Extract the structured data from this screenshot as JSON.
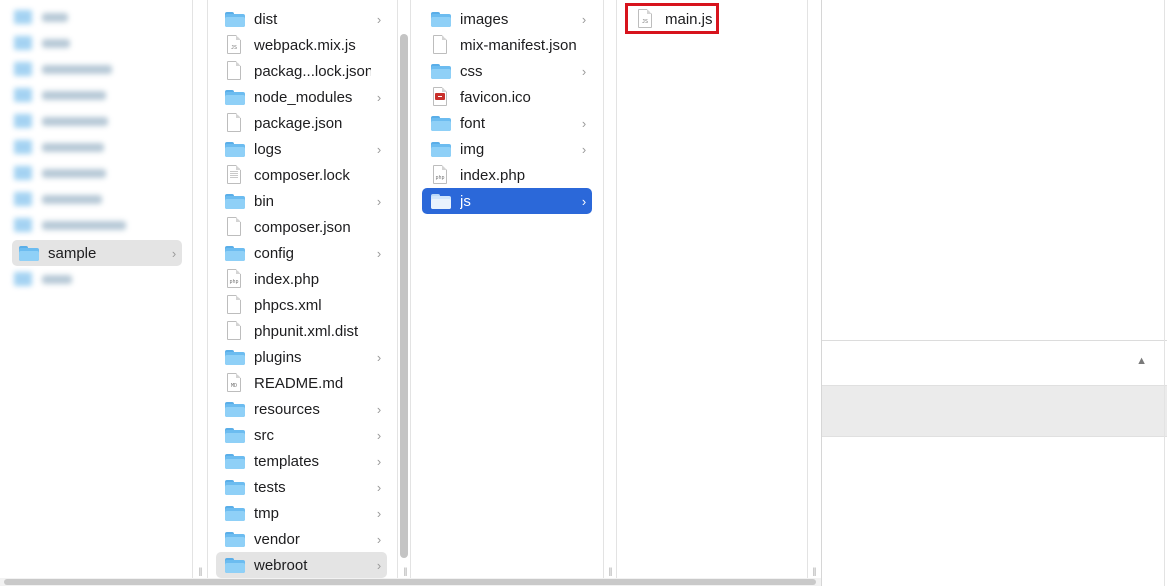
{
  "sidebar": {
    "selected_label": "sample",
    "chevron": "›"
  },
  "column1": {
    "items": [
      {
        "label": "dist",
        "kind": "folder"
      },
      {
        "label": "webpack.mix.js",
        "kind": "doc"
      },
      {
        "label": "packag...lock.json",
        "kind": "doc"
      },
      {
        "label": "node_modules",
        "kind": "folder"
      },
      {
        "label": "package.json",
        "kind": "doc"
      },
      {
        "label": "logs",
        "kind": "folder"
      },
      {
        "label": "composer.lock",
        "kind": "doc"
      },
      {
        "label": "bin",
        "kind": "folder"
      },
      {
        "label": "composer.json",
        "kind": "doc"
      },
      {
        "label": "config",
        "kind": "folder"
      },
      {
        "label": "index.php",
        "kind": "doc"
      },
      {
        "label": "phpcs.xml",
        "kind": "doc"
      },
      {
        "label": "phpunit.xml.dist",
        "kind": "doc"
      },
      {
        "label": "plugins",
        "kind": "folder"
      },
      {
        "label": "README.md",
        "kind": "doc"
      },
      {
        "label": "resources",
        "kind": "folder"
      },
      {
        "label": "src",
        "kind": "folder"
      },
      {
        "label": "templates",
        "kind": "folder"
      },
      {
        "label": "tests",
        "kind": "folder"
      },
      {
        "label": "tmp",
        "kind": "folder"
      },
      {
        "label": "vendor",
        "kind": "folder"
      },
      {
        "label": "webroot",
        "kind": "folder"
      }
    ]
  },
  "column2": {
    "items": [
      {
        "label": "images",
        "kind": "folder"
      },
      {
        "label": "mix-manifest.json",
        "kind": "doc"
      },
      {
        "label": "css",
        "kind": "folder"
      },
      {
        "label": "favicon.ico",
        "kind": "doc"
      },
      {
        "label": "font",
        "kind": "folder"
      },
      {
        "label": "img",
        "kind": "folder"
      },
      {
        "label": "index.php",
        "kind": "doc"
      },
      {
        "label": "js",
        "kind": "folder"
      }
    ]
  },
  "column3": {
    "items": [
      {
        "label": "main.js",
        "kind": "doc"
      }
    ]
  },
  "icons": {
    "folder": "folder-icon",
    "document": "document-icon",
    "chevron": "chevron-right-icon",
    "collapse": "collapse-arrow-icon"
  },
  "glyphs": {
    "chevron": "›",
    "collapse_arrow": "▲",
    "grip": "||",
    "js_tag": "JS",
    "php_tag": "php",
    "md_tag": "MD",
    "xml_tag": "</>"
  },
  "colors": {
    "selection_blue": "#2b68d9",
    "selection_grey": "#e4e4e4",
    "highlight_red": "#d7131d",
    "folder_blue": "#6cbcf0"
  }
}
